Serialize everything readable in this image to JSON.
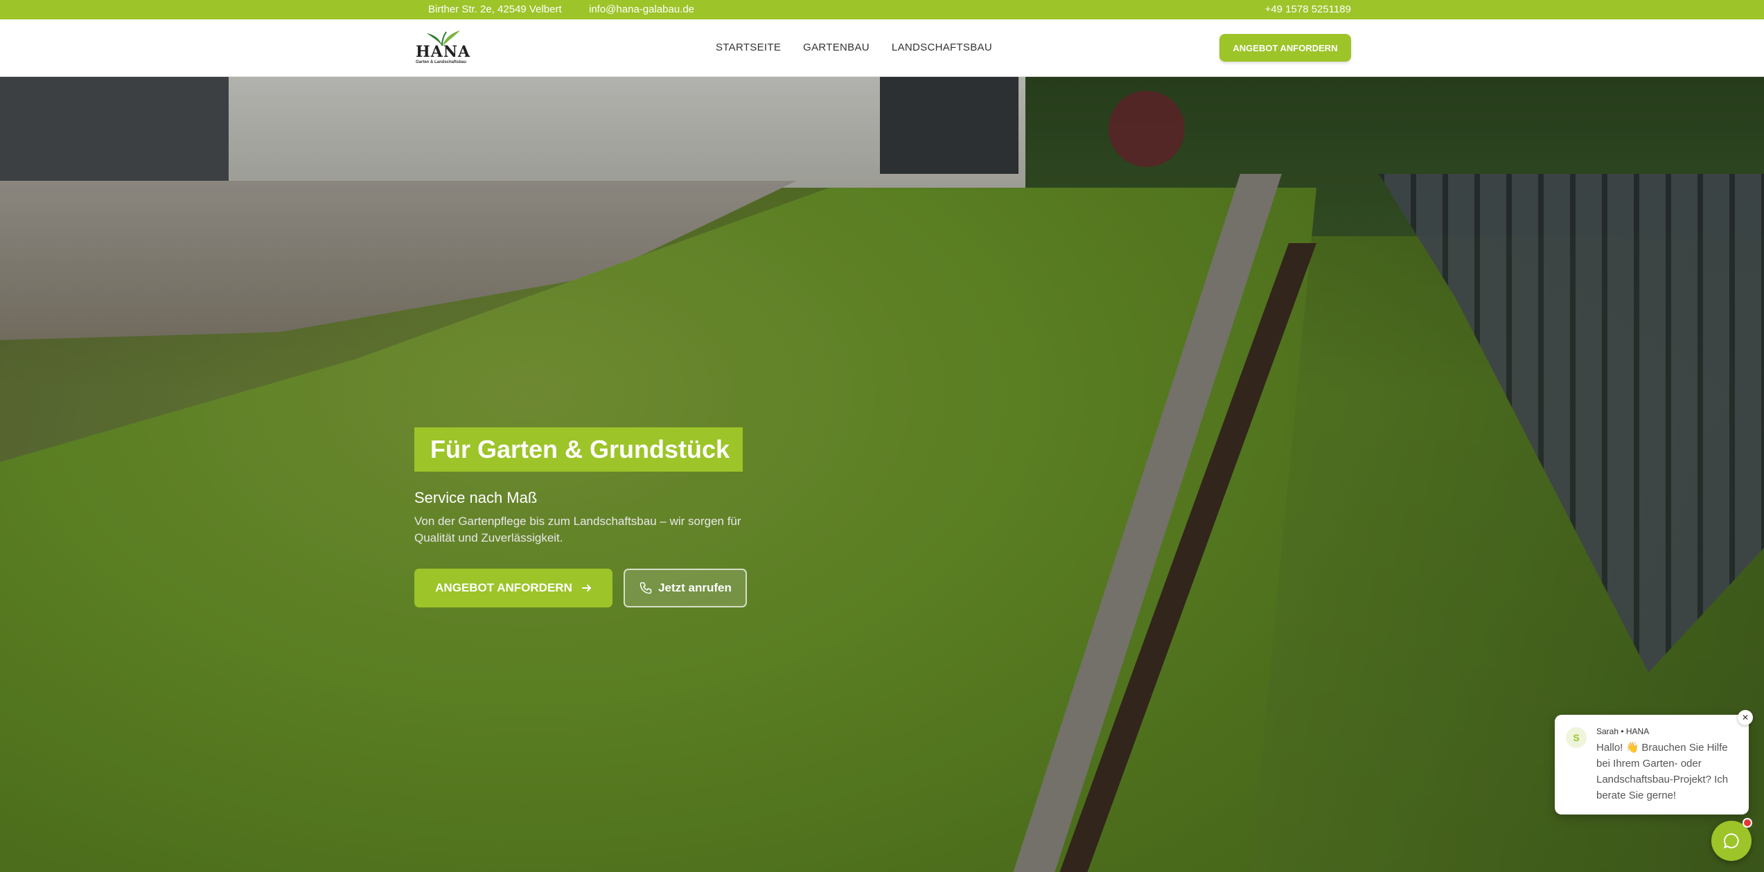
{
  "topbar": {
    "address": "Birther Str. 2e, 42549 Velbert",
    "email": "info@hana-galabau.de",
    "phone": "+49 1578 5251189"
  },
  "header": {
    "logo_brand": "HANA",
    "logo_tagline": "Garten & Landschaftsbau",
    "nav": [
      "STARTSEITE",
      "GARTENBAU",
      "LANDSCHAFTSBAU"
    ],
    "cta_label": "ANGEBOT ANFORDERN"
  },
  "hero": {
    "title": "Für Garten & Grundstück",
    "subtitle": "Service nach Maß",
    "description": "Von der Gartenpflege bis zum Landschaftsbau – wir sorgen für Qualität und Zuverlässigkeit.",
    "primary_button": "ANGEBOT ANFORDERN",
    "secondary_button": "Jetzt anrufen"
  },
  "chat": {
    "avatar_initial": "S",
    "sender": "Sarah • HANA",
    "message": "Hallo! 👋 Brauchen Sie Hilfe bei Ihrem Garten- oder Landschaftsbau-Projekt? Ich berate Sie gerne!",
    "close_symbol": "✕"
  },
  "colors": {
    "accent": "#9dc429",
    "notification": "#e53935"
  },
  "icons": [
    "arrow-right-icon",
    "phone-icon",
    "close-icon",
    "chat-bubble-icon",
    "leaf-logo-icon"
  ]
}
